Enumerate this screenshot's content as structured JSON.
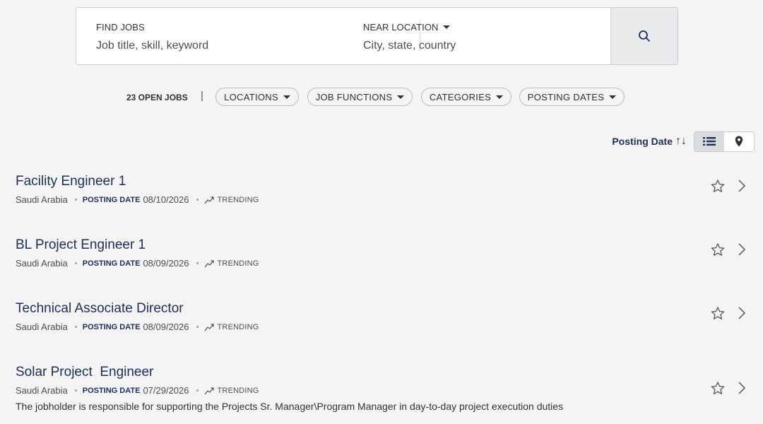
{
  "search": {
    "find_label": "FIND JOBS",
    "find_placeholder": "Job title, skill, keyword",
    "location_label": "NEAR LOCATION",
    "location_placeholder": "City, state, country"
  },
  "filters": {
    "count_label": "23 OPEN JOBS",
    "separator": "|",
    "pills": [
      "LOCATIONS",
      "JOB FUNCTIONS",
      "CATEGORIES",
      "POSTING DATES"
    ]
  },
  "sort": {
    "label": "Posting Date",
    "arrows": "↑↓"
  },
  "jobs": [
    {
      "title": "Facility Engineer 1",
      "location": "Saudi Arabia",
      "posting_label": "POSTING DATE",
      "date": "08/10/2026",
      "tag": "TRENDING"
    },
    {
      "title": "BL Project Engineer 1",
      "location": "Saudi Arabia",
      "posting_label": "POSTING DATE",
      "date": "08/09/2026",
      "tag": "TRENDING"
    },
    {
      "title": "Technical Associate Director",
      "location": "Saudi Arabia",
      "posting_label": "POSTING DATE",
      "date": "08/09/2026",
      "tag": "TRENDING"
    },
    {
      "title": "Solar Project  Engineer",
      "location": "Saudi Arabia",
      "posting_label": "POSTING DATE",
      "date": "07/29/2026",
      "tag": "TRENDING",
      "description": "The jobholder is responsible for supporting the Projects Sr. Manager\\Program Manager in day-to-day project execution duties"
    }
  ],
  "colors": {
    "accent": "#1f2d5a",
    "background": "#f3f4f3"
  }
}
